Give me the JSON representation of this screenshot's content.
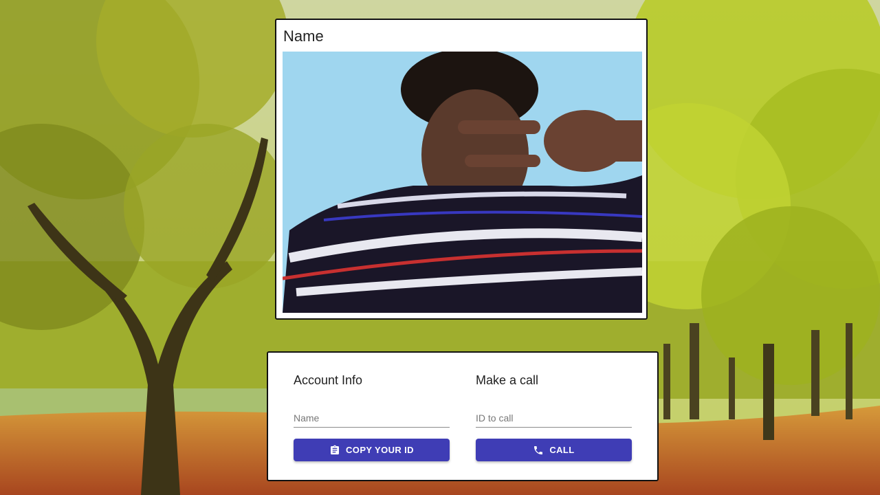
{
  "video": {
    "name_label": "Name"
  },
  "account": {
    "title": "Account Info",
    "name_placeholder": "Name",
    "copy_button_label": "COPY YOUR ID",
    "copy_button_icon": "clipboard-icon"
  },
  "call": {
    "title": "Make a call",
    "id_placeholder": "ID to call",
    "call_button_label": "CALL",
    "call_button_icon": "phone-icon"
  },
  "colors": {
    "button": "#3f3db5",
    "panel_border": "#111111"
  }
}
